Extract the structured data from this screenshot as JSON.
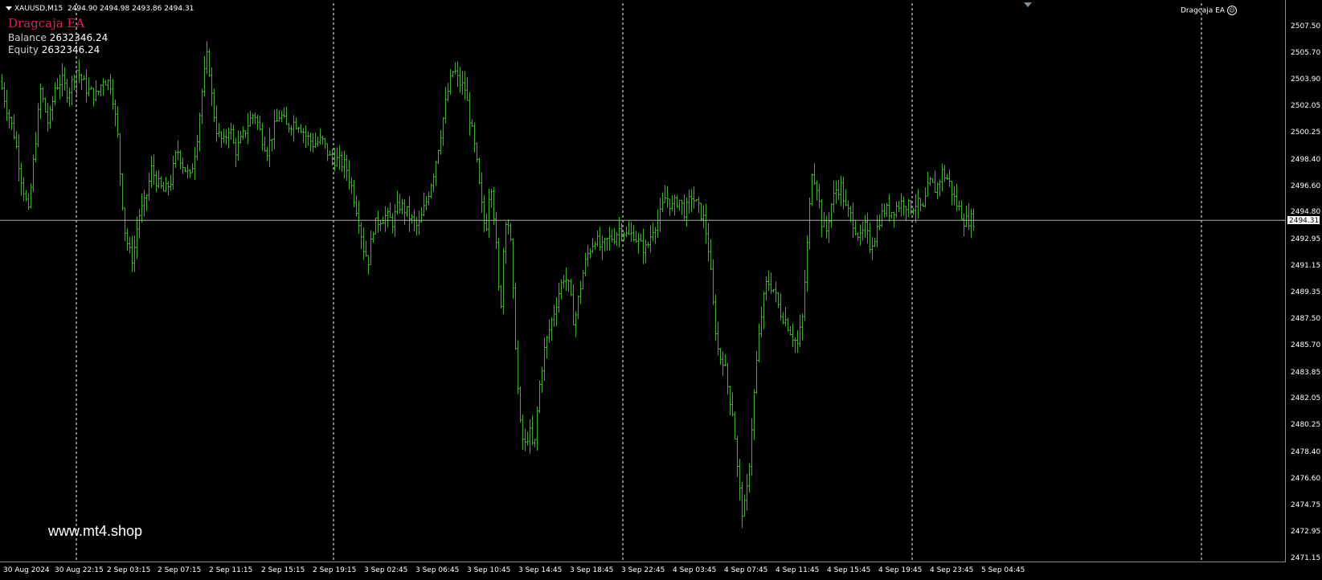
{
  "symbol": {
    "name": "XAUUSD,M15",
    "ohlc": "2494.90 2494.98 2493.86 2494.31"
  },
  "ea": {
    "title": "Dragcaja EA",
    "corner_label": "Dragcaja EA"
  },
  "account": {
    "balance_label": "Balance",
    "balance_value": "2632346.24",
    "equity_label": "Equity",
    "equity_value": "2632346.24"
  },
  "watermark": "www.mt4.shop",
  "current_price": "2494.31",
  "colors": {
    "background": "#000000",
    "candle": "#3fae2b",
    "bid_line": "#b0b0b0",
    "grid": "#ffffff",
    "ea_title": "#e0205a"
  },
  "price_axis": [
    "2507.50",
    "2505.70",
    "2503.90",
    "2502.05",
    "2500.25",
    "2498.40",
    "2496.60",
    "2494.80",
    "2492.95",
    "2491.15",
    "2489.35",
    "2487.50",
    "2485.70",
    "2483.85",
    "2482.05",
    "2480.25",
    "2478.40",
    "2476.60",
    "2474.75",
    "2472.95",
    "2471.15"
  ],
  "time_axis": [
    "30 Aug 2024",
    "30 Aug 22:15",
    "2 Sep 03:15",
    "2 Sep 07:15",
    "2 Sep 11:15",
    "2 Sep 15:15",
    "2 Sep 19:15",
    "3 Sep 02:45",
    "3 Sep 06:45",
    "3 Sep 10:45",
    "3 Sep 14:45",
    "3 Sep 18:45",
    "3 Sep 22:45",
    "4 Sep 03:45",
    "4 Sep 07:45",
    "4 Sep 11:45",
    "4 Sep 15:45",
    "4 Sep 19:45",
    "4 Sep 23:45",
    "5 Sep 04:45"
  ],
  "chart_data": {
    "type": "candlestick",
    "symbol": "XAUUSD",
    "timeframe": "M15",
    "ylim": [
      2470.5,
      2508.5
    ],
    "close_path": [
      [
        0,
        2503.8
      ],
      [
        8,
        2502.0
      ],
      [
        18,
        2500.0
      ],
      [
        26,
        2497.2
      ],
      [
        35,
        2494.8
      ],
      [
        42,
        2498.8
      ],
      [
        50,
        2503.2
      ],
      [
        60,
        2500.8
      ],
      [
        68,
        2503.4
      ],
      [
        76,
        2503.9
      ],
      [
        84,
        2503.0
      ],
      [
        95,
        2504.6
      ],
      [
        108,
        2503.2
      ],
      [
        120,
        2502.8
      ],
      [
        128,
        2504.0
      ],
      [
        138,
        2503.6
      ],
      [
        146,
        2500.0
      ],
      [
        150,
        2496.8
      ],
      [
        155,
        2493.6
      ],
      [
        160,
        2492.2
      ],
      [
        165,
        2491.6
      ],
      [
        172,
        2494.6
      ],
      [
        180,
        2495.5
      ],
      [
        188,
        2497.8
      ],
      [
        196,
        2496.8
      ],
      [
        204,
        2496.2
      ],
      [
        212,
        2497.0
      ],
      [
        220,
        2499.2
      ],
      [
        228,
        2498.0
      ],
      [
        236,
        2497.2
      ],
      [
        244,
        2499.6
      ],
      [
        252,
        2503.6
      ],
      [
        258,
        2505.8
      ],
      [
        264,
        2502.2
      ],
      [
        270,
        2500.2
      ],
      [
        278,
        2499.6
      ],
      [
        285,
        2500.8
      ],
      [
        292,
        2499.0
      ],
      [
        300,
        2499.8
      ],
      [
        308,
        2500.9
      ],
      [
        316,
        2501.7
      ],
      [
        324,
        2500.2
      ],
      [
        332,
        2499.1
      ],
      [
        340,
        2500.5
      ],
      [
        348,
        2501.6
      ],
      [
        356,
        2500.7
      ],
      [
        364,
        2501.0
      ],
      [
        372,
        2500.9
      ],
      [
        380,
        2500.1
      ],
      [
        390,
        2499.5
      ],
      [
        400,
        2499.8
      ],
      [
        410,
        2498.6
      ],
      [
        420,
        2498.4
      ],
      [
        430,
        2498.0
      ],
      [
        438,
        2496.4
      ],
      [
        446,
        2494.4
      ],
      [
        452,
        2492.4
      ],
      [
        458,
        2491.6
      ],
      [
        464,
        2493.8
      ],
      [
        472,
        2494.4
      ],
      [
        480,
        2494.6
      ],
      [
        488,
        2494.2
      ],
      [
        496,
        2495.4
      ],
      [
        504,
        2495.0
      ],
      [
        512,
        2494.3
      ],
      [
        520,
        2493.8
      ],
      [
        530,
        2495.6
      ],
      [
        540,
        2497.8
      ],
      [
        548,
        2500.3
      ],
      [
        556,
        2502.9
      ],
      [
        564,
        2504.7
      ],
      [
        570,
        2503.8
      ],
      [
        578,
        2503.3
      ],
      [
        585,
        2501.0
      ],
      [
        592,
        2498.6
      ],
      [
        598,
        2495.6
      ],
      [
        604,
        2493.4
      ],
      [
        610,
        2497.4
      ],
      [
        616,
        2493.4
      ],
      [
        622,
        2487.6
      ],
      [
        628,
        2494.6
      ],
      [
        634,
        2493.8
      ],
      [
        640,
        2487.0
      ],
      [
        646,
        2480.6
      ],
      [
        652,
        2478.7
      ],
      [
        658,
        2480.0
      ],
      [
        664,
        2478.4
      ],
      [
        670,
        2482.6
      ],
      [
        676,
        2485.2
      ],
      [
        682,
        2486.6
      ],
      [
        690,
        2488.3
      ],
      [
        696,
        2489.6
      ],
      [
        702,
        2490.6
      ],
      [
        708,
        2489.6
      ],
      [
        714,
        2487.2
      ],
      [
        720,
        2489.2
      ],
      [
        726,
        2491.0
      ],
      [
        732,
        2492.2
      ],
      [
        740,
        2493.1
      ],
      [
        748,
        2492.3
      ],
      [
        756,
        2493.0
      ],
      [
        764,
        2493.2
      ],
      [
        772,
        2493.9
      ],
      [
        780,
        2493.2
      ],
      [
        788,
        2493.4
      ],
      [
        796,
        2492.6
      ],
      [
        804,
        2492.3
      ],
      [
        812,
        2493.8
      ],
      [
        820,
        2494.5
      ],
      [
        828,
        2496.0
      ],
      [
        836,
        2495.2
      ],
      [
        844,
        2495.8
      ],
      [
        852,
        2494.8
      ],
      [
        860,
        2496.0
      ],
      [
        868,
        2495.2
      ],
      [
        876,
        2494.3
      ],
      [
        882,
        2492.0
      ],
      [
        888,
        2487.8
      ],
      [
        894,
        2485.0
      ],
      [
        900,
        2484.8
      ],
      [
        906,
        2482.6
      ],
      [
        912,
        2481.0
      ],
      [
        918,
        2476.6
      ],
      [
        924,
        2474.0
      ],
      [
        930,
        2476.2
      ],
      [
        936,
        2481.0
      ],
      [
        942,
        2485.3
      ],
      [
        948,
        2488.3
      ],
      [
        954,
        2490.2
      ],
      [
        962,
        2489.6
      ],
      [
        970,
        2488.1
      ],
      [
        978,
        2487.4
      ],
      [
        986,
        2486.4
      ],
      [
        992,
        2485.8
      ],
      [
        998,
        2487.6
      ],
      [
        1004,
        2492.6
      ],
      [
        1010,
        2497.8
      ],
      [
        1016,
        2496.7
      ],
      [
        1022,
        2494.2
      ],
      [
        1028,
        2493.6
      ],
      [
        1034,
        2495.4
      ],
      [
        1040,
        2496.4
      ],
      [
        1046,
        2496.6
      ],
      [
        1052,
        2495.1
      ],
      [
        1058,
        2494.6
      ],
      [
        1064,
        2493.8
      ],
      [
        1070,
        2493.0
      ],
      [
        1076,
        2493.8
      ],
      [
        1082,
        2492.6
      ],
      [
        1088,
        2493.2
      ],
      [
        1094,
        2494.4
      ],
      [
        1100,
        2495.0
      ],
      [
        1108,
        2494.9
      ],
      [
        1116,
        2495.3
      ],
      [
        1124,
        2495.6
      ],
      [
        1132,
        2495.1
      ],
      [
        1140,
        2495.5
      ],
      [
        1148,
        2495.0
      ],
      [
        1156,
        2496.9
      ],
      [
        1164,
        2496.4
      ],
      [
        1172,
        2497.6
      ],
      [
        1180,
        2497.0
      ],
      [
        1188,
        2495.6
      ],
      [
        1194,
        2495.0
      ],
      [
        1200,
        2494.2
      ],
      [
        1206,
        2494.4
      ],
      [
        1212,
        2494.31
      ]
    ],
    "bid_line": 2494.31
  }
}
